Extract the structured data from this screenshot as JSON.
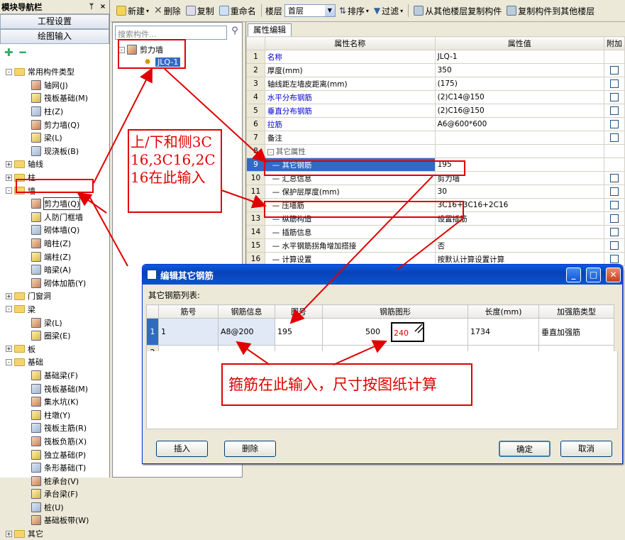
{
  "nav": {
    "title": "模块导航栏",
    "pin": "ᛘ",
    "close": "×",
    "btn_project": "工程设置",
    "btn_draw": "绘图输入",
    "tools_add": "✚",
    "tools_remove": "━",
    "tree": [
      {
        "level": 0,
        "exp": "-",
        "type": "folder",
        "label": "常用构件类型"
      },
      {
        "level": 1,
        "type": "icon",
        "label": "轴网(J)"
      },
      {
        "level": 1,
        "type": "icon",
        "label": "筏板基础(M)"
      },
      {
        "level": 1,
        "type": "icon",
        "label": "柱(Z)"
      },
      {
        "level": 1,
        "type": "icon",
        "label": "剪力墙(Q)"
      },
      {
        "level": 1,
        "type": "icon",
        "label": "梁(L)"
      },
      {
        "level": 1,
        "type": "icon",
        "label": "现浇板(B)"
      },
      {
        "level": 0,
        "exp": "+",
        "type": "folder",
        "label": "轴线"
      },
      {
        "level": 0,
        "exp": "+",
        "type": "folder",
        "label": "柱"
      },
      {
        "level": 0,
        "exp": "-",
        "type": "folder",
        "label": "墙"
      },
      {
        "level": 1,
        "type": "icon",
        "label": "剪力墙(Q)",
        "selected": true
      },
      {
        "level": 1,
        "type": "icon",
        "label": "人防门框墙"
      },
      {
        "level": 1,
        "type": "icon",
        "label": "砌体墙(Q)"
      },
      {
        "level": 1,
        "type": "icon",
        "label": "暗柱(Z)"
      },
      {
        "level": 1,
        "type": "icon",
        "label": "端柱(Z)"
      },
      {
        "level": 1,
        "type": "icon",
        "label": "暗梁(A)"
      },
      {
        "level": 1,
        "type": "icon",
        "label": "砌体加筋(Y)"
      },
      {
        "level": 0,
        "exp": "+",
        "type": "folder",
        "label": "门窗洞"
      },
      {
        "level": 0,
        "exp": "-",
        "type": "folder",
        "label": "梁"
      },
      {
        "level": 1,
        "type": "icon",
        "label": "梁(L)"
      },
      {
        "level": 1,
        "type": "icon",
        "label": "圈梁(E)"
      },
      {
        "level": 0,
        "exp": "+",
        "type": "folder",
        "label": "板"
      },
      {
        "level": 0,
        "exp": "-",
        "type": "folder",
        "label": "基础"
      },
      {
        "level": 1,
        "type": "icon",
        "label": "基础梁(F)"
      },
      {
        "level": 1,
        "type": "icon",
        "label": "筏板基础(M)"
      },
      {
        "level": 1,
        "type": "icon",
        "label": "集水坑(K)"
      },
      {
        "level": 1,
        "type": "icon",
        "label": "柱墩(Y)"
      },
      {
        "level": 1,
        "type": "icon",
        "label": "筏板主筋(R)"
      },
      {
        "level": 1,
        "type": "icon",
        "label": "筏板负筋(X)"
      },
      {
        "level": 1,
        "type": "icon",
        "label": "独立基础(P)"
      },
      {
        "level": 1,
        "type": "icon",
        "label": "条形基础(T)"
      },
      {
        "level": 1,
        "type": "icon",
        "label": "桩承台(V)"
      },
      {
        "level": 1,
        "type": "icon",
        "label": "承台梁(F)"
      },
      {
        "level": 1,
        "type": "icon",
        "label": "桩(U)"
      },
      {
        "level": 1,
        "type": "icon",
        "label": "基础板带(W)"
      },
      {
        "level": 0,
        "exp": "+",
        "type": "folder",
        "label": "其它"
      }
    ]
  },
  "toolbar": {
    "new": "新建",
    "delete": "删除",
    "copy": "复制",
    "rename": "重命名",
    "floor_label": "楼层",
    "floor_value": "首层",
    "sort": "排序",
    "filter": "过滤",
    "copy_from": "从其他楼层复制构件",
    "copy_to": "复制构件到其他楼层"
  },
  "comp": {
    "search_placeholder": "搜索构件...",
    "search_icon": "⚲",
    "root": "剪力墙",
    "child": "JLQ-1"
  },
  "props": {
    "tab": "属性编辑",
    "col_name": "属性名称",
    "col_value": "属性值",
    "col_add": "附加",
    "rows": [
      {
        "n": "1",
        "name": "名称",
        "value": "JLQ-1",
        "blue": true,
        "cb": false
      },
      {
        "n": "2",
        "name": "厚度(mm)",
        "value": "350",
        "cb": true
      },
      {
        "n": "3",
        "name": "轴线距左墙皮距离(mm)",
        "value": "(175)",
        "cb": true
      },
      {
        "n": "4",
        "name": "水平分布钢筋",
        "value": "(2)C14@150",
        "blue": true,
        "cb": true
      },
      {
        "n": "5",
        "name": "垂直分布钢筋",
        "value": "(2)C16@150",
        "blue": true,
        "cb": true
      },
      {
        "n": "6",
        "name": "拉筋",
        "value": "A6@600*600",
        "blue": true,
        "cb": true
      },
      {
        "n": "7",
        "name": "备注",
        "value": "",
        "cb": true
      },
      {
        "n": "8",
        "name": "其它属性",
        "value": "",
        "group": true
      },
      {
        "n": "9",
        "name": "其它钢筋",
        "value": "195",
        "sub": true,
        "selected": true
      },
      {
        "n": "10",
        "name": "汇总信息",
        "value": "剪力墙",
        "sub": true,
        "cb": true
      },
      {
        "n": "11",
        "name": "保护层厚度(mm)",
        "value": "30",
        "sub": true,
        "cb": true
      },
      {
        "n": "12",
        "name": "压墙筋",
        "value": "3C16+3C16+2C16",
        "sub": true,
        "cb": true
      },
      {
        "n": "13",
        "name": "纵筋构造",
        "value": "设置插筋",
        "sub": true,
        "cb": true
      },
      {
        "n": "14",
        "name": "插筋信息",
        "value": "",
        "sub": true,
        "cb": true
      },
      {
        "n": "15",
        "name": "水平钢筋拐角增加搭接",
        "value": "否",
        "sub": true,
        "cb": true
      },
      {
        "n": "16",
        "name": "计算设置",
        "value": "按默认计算设置计算",
        "sub": true,
        "cb": true
      }
    ]
  },
  "dialog": {
    "title": "编辑其它钢筋",
    "list_label": "其它钢筋列表:",
    "cols": [
      "筋号",
      "钢筋信息",
      "图号",
      "钢筋图形",
      "长度(mm)",
      "加强筋类型"
    ],
    "rows": [
      {
        "n": "1",
        "bar_no": "1",
        "info": "A8@200",
        "fig": "195",
        "dim1": "500",
        "dim2": "240",
        "length": "1734",
        "type": "垂直加强筋"
      },
      {
        "n": "2",
        "bar_no": "",
        "info": "",
        "fig": "",
        "dim1": "",
        "dim2": "",
        "length": "",
        "type": ""
      }
    ],
    "insert": "插入",
    "delete": "删除",
    "ok": "确定",
    "cancel": "取消"
  },
  "annotations": {
    "note1": "上/下和侧3C16,3C16,2C16在此输入",
    "note2": "箍筋在此输入，尺寸按图纸计算",
    "color": "#e00000"
  }
}
